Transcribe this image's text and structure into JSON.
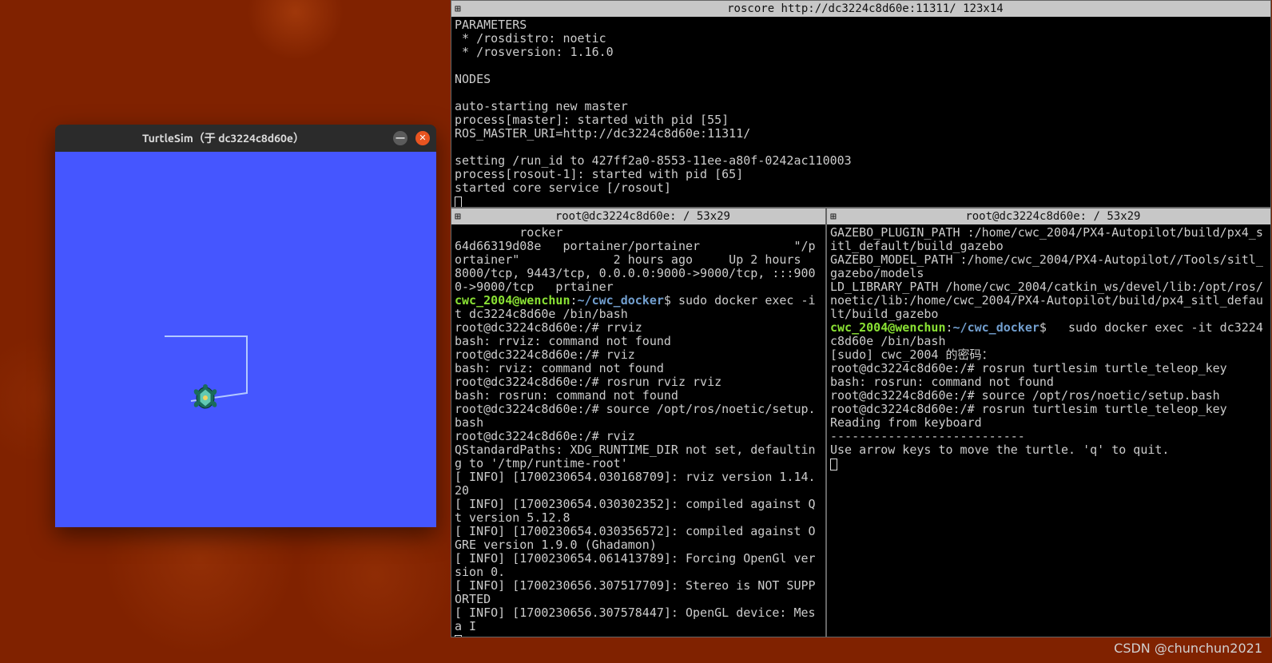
{
  "turtlesim": {
    "title": "TurtleSim（于 dc3224c8d60e）"
  },
  "panes": {
    "top": {
      "title": "roscore http://dc3224c8d60e:11311/ 123x14",
      "lines": [
        {
          "t": "PARAMETERS"
        },
        {
          "t": " * /rosdistro: noetic"
        },
        {
          "t": " * /rosversion: 1.16.0"
        },
        {
          "t": ""
        },
        {
          "t": "NODES"
        },
        {
          "t": ""
        },
        {
          "t": "auto-starting new master"
        },
        {
          "t": "process[master]: started with pid [55]"
        },
        {
          "t": "ROS_MASTER_URI=http://dc3224c8d60e:11311/"
        },
        {
          "t": ""
        },
        {
          "t": "setting /run_id to 427ff2a0-8553-11ee-a80f-0242ac110003"
        },
        {
          "t": "process[rosout-1]: started with pid [65]"
        },
        {
          "t": "started core service [/rosout]"
        }
      ]
    },
    "left": {
      "title": "root@dc3224c8d60e: / 53x29",
      "pre": "         rocker\n64d66319d08e   portainer/portainer             \"/portainer\"             2 hours ago     Up 2 hours     8000/tcp, 9443/tcp, 0.0.0.0:9000->9000/tcp, :::9000->9000/tcp   prtainer\n",
      "prompt_user": "cwc_2004@wenchun",
      "prompt_path": "~/cwc_docker",
      "prompt_cmd": "sudo docker exec -it dc3224c8d60e /bin/bash",
      "after": "root@dc3224c8d60e:/# rrviz\nbash: rrviz: command not found\nroot@dc3224c8d60e:/# rviz\nbash: rviz: command not found\nroot@dc3224c8d60e:/# rosrun rviz rviz\nbash: rosrun: command not found\nroot@dc3224c8d60e:/# source /opt/ros/noetic/setup.bash\nroot@dc3224c8d60e:/# rviz\nQStandardPaths: XDG_RUNTIME_DIR not set, defaulting to '/tmp/runtime-root'\n[ INFO] [1700230654.030168709]: rviz version 1.14.20\n[ INFO] [1700230654.030302352]: compiled against Qt version 5.12.8\n[ INFO] [1700230654.030356572]: compiled against OGRE version 1.9.0 (Ghadamon)\n[ INFO] [1700230654.061413789]: Forcing OpenGl version 0.\n[ INFO] [1700230656.307517709]: Stereo is NOT SUPPORTED\n[ INFO] [1700230656.307578447]: OpenGL device: Mesa I"
    },
    "right": {
      "title": "root@dc3224c8d60e: / 53x29",
      "pre": "GAZEBO_PLUGIN_PATH :/home/cwc_2004/PX4-Autopilot/build/px4_sitl_default/build_gazebo\nGAZEBO_MODEL_PATH :/home/cwc_2004/PX4-Autopilot//Tools/sitl_gazebo/models\nLD_LIBRARY_PATH /home/cwc_2004/catkin_ws/devel/lib:/opt/ros/noetic/lib:/home/cwc_2004/PX4-Autopilot/build/px4_sitl_default/build_gazebo\n",
      "prompt_user": "cwc_2004@wenchun",
      "prompt_path": "~/cwc_docker",
      "prompt_cmd": "  sudo docker exec -it dc3224c8d60e /bin/bash",
      "after": "[sudo] cwc_2004 的密码：\nroot@dc3224c8d60e:/# rosrun turtlesim turtle_teleop_key\nbash: rosrun: command not found\nroot@dc3224c8d60e:/# source /opt/ros/noetic/setup.bash\nroot@dc3224c8d60e:/# rosrun turtlesim turtle_teleop_key\nReading from keyboard\n---------------------------\nUse arrow keys to move the turtle. 'q' to quit."
    }
  },
  "watermark": "CSDN @chunchun2021"
}
